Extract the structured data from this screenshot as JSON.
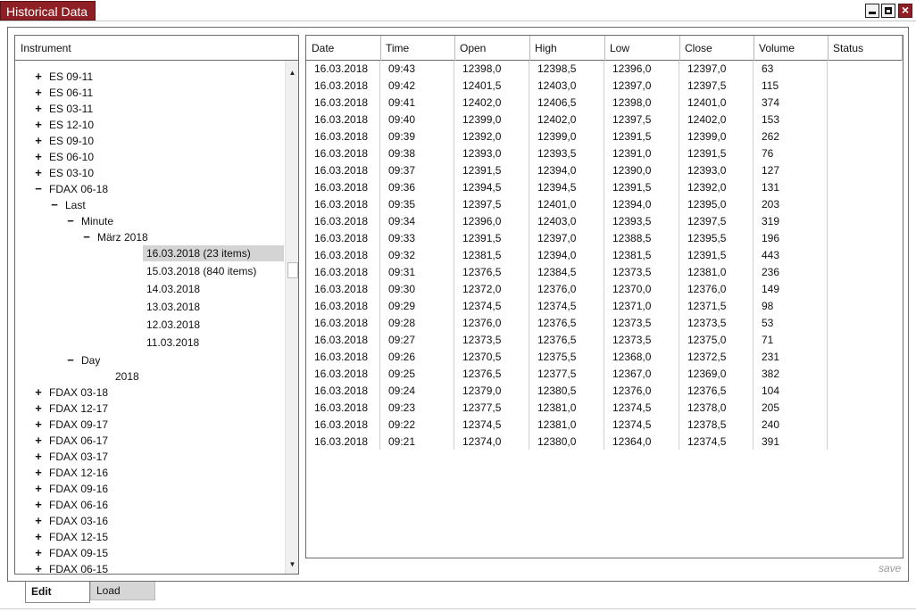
{
  "window": {
    "title": "Historical Data",
    "accent_color": "#8e1f24"
  },
  "tree": {
    "header": "Instrument",
    "items": [
      {
        "label": "ES 09-11",
        "toggle": "+",
        "level": 0
      },
      {
        "label": "ES 06-11",
        "toggle": "+",
        "level": 0
      },
      {
        "label": "ES 03-11",
        "toggle": "+",
        "level": 0
      },
      {
        "label": "ES 12-10",
        "toggle": "+",
        "level": 0
      },
      {
        "label": "ES 09-10",
        "toggle": "+",
        "level": 0
      },
      {
        "label": "ES 06-10",
        "toggle": "+",
        "level": 0
      },
      {
        "label": "ES 03-10",
        "toggle": "+",
        "level": 0
      },
      {
        "label": "FDAX 06-18",
        "toggle": "−",
        "level": 0
      },
      {
        "label": "Last",
        "toggle": "−",
        "level": 1
      },
      {
        "label": "Minute",
        "toggle": "−",
        "level": 2
      },
      {
        "label": "März 2018",
        "toggle": "−",
        "level": 3
      },
      {
        "label": "16.03.2018 (23 items)",
        "toggle": "",
        "level": 4,
        "selected": true
      },
      {
        "label": "15.03.2018 (840 items)",
        "toggle": "",
        "level": 4
      },
      {
        "label": "14.03.2018",
        "toggle": "",
        "level": 4
      },
      {
        "label": "13.03.2018",
        "toggle": "",
        "level": 4
      },
      {
        "label": "12.03.2018",
        "toggle": "",
        "level": 4
      },
      {
        "label": "11.03.2018",
        "toggle": "",
        "level": 4
      },
      {
        "label": "Day",
        "toggle": "−",
        "level": 2
      },
      {
        "label": "2018",
        "toggle": "",
        "level": 3
      },
      {
        "label": "FDAX 03-18",
        "toggle": "+",
        "level": 0
      },
      {
        "label": "FDAX 12-17",
        "toggle": "+",
        "level": 0
      },
      {
        "label": "FDAX 09-17",
        "toggle": "+",
        "level": 0
      },
      {
        "label": "FDAX 06-17",
        "toggle": "+",
        "level": 0
      },
      {
        "label": "FDAX 03-17",
        "toggle": "+",
        "level": 0
      },
      {
        "label": "FDAX 12-16",
        "toggle": "+",
        "level": 0
      },
      {
        "label": "FDAX 09-16",
        "toggle": "+",
        "level": 0
      },
      {
        "label": "FDAX 06-16",
        "toggle": "+",
        "level": 0
      },
      {
        "label": "FDAX 03-16",
        "toggle": "+",
        "level": 0
      },
      {
        "label": "FDAX 12-15",
        "toggle": "+",
        "level": 0
      },
      {
        "label": "FDAX 09-15",
        "toggle": "+",
        "level": 0
      },
      {
        "label": "FDAX 06-15",
        "toggle": "+",
        "level": 0
      }
    ]
  },
  "grid": {
    "columns": [
      "Date",
      "Time",
      "Open",
      "High",
      "Low",
      "Close",
      "Volume",
      "Status"
    ],
    "rows": [
      [
        "16.03.2018",
        "09:43",
        "12398,0",
        "12398,5",
        "12396,0",
        "12397,0",
        "63",
        ""
      ],
      [
        "16.03.2018",
        "09:42",
        "12401,5",
        "12403,0",
        "12397,0",
        "12397,5",
        "115",
        ""
      ],
      [
        "16.03.2018",
        "09:41",
        "12402,0",
        "12406,5",
        "12398,0",
        "12401,0",
        "374",
        ""
      ],
      [
        "16.03.2018",
        "09:40",
        "12399,0",
        "12402,0",
        "12397,5",
        "12402,0",
        "153",
        ""
      ],
      [
        "16.03.2018",
        "09:39",
        "12392,0",
        "12399,0",
        "12391,5",
        "12399,0",
        "262",
        ""
      ],
      [
        "16.03.2018",
        "09:38",
        "12393,0",
        "12393,5",
        "12391,0",
        "12391,5",
        "76",
        ""
      ],
      [
        "16.03.2018",
        "09:37",
        "12391,5",
        "12394,0",
        "12390,0",
        "12393,0",
        "127",
        ""
      ],
      [
        "16.03.2018",
        "09:36",
        "12394,5",
        "12394,5",
        "12391,5",
        "12392,0",
        "131",
        ""
      ],
      [
        "16.03.2018",
        "09:35",
        "12397,5",
        "12401,0",
        "12394,0",
        "12395,0",
        "203",
        ""
      ],
      [
        "16.03.2018",
        "09:34",
        "12396,0",
        "12403,0",
        "12393,5",
        "12397,5",
        "319",
        ""
      ],
      [
        "16.03.2018",
        "09:33",
        "12391,5",
        "12397,0",
        "12388,5",
        "12395,5",
        "196",
        ""
      ],
      [
        "16.03.2018",
        "09:32",
        "12381,5",
        "12394,0",
        "12381,5",
        "12391,5",
        "443",
        ""
      ],
      [
        "16.03.2018",
        "09:31",
        "12376,5",
        "12384,5",
        "12373,5",
        "12381,0",
        "236",
        ""
      ],
      [
        "16.03.2018",
        "09:30",
        "12372,0",
        "12376,0",
        "12370,0",
        "12376,0",
        "149",
        ""
      ],
      [
        "16.03.2018",
        "09:29",
        "12374,5",
        "12374,5",
        "12371,0",
        "12371,5",
        "98",
        ""
      ],
      [
        "16.03.2018",
        "09:28",
        "12376,0",
        "12376,5",
        "12373,5",
        "12373,5",
        "53",
        ""
      ],
      [
        "16.03.2018",
        "09:27",
        "12373,5",
        "12376,5",
        "12373,5",
        "12375,0",
        "71",
        ""
      ],
      [
        "16.03.2018",
        "09:26",
        "12370,5",
        "12375,5",
        "12368,0",
        "12372,5",
        "231",
        ""
      ],
      [
        "16.03.2018",
        "09:25",
        "12376,5",
        "12377,5",
        "12367,0",
        "12369,0",
        "382",
        ""
      ],
      [
        "16.03.2018",
        "09:24",
        "12379,0",
        "12380,5",
        "12376,0",
        "12376,5",
        "104",
        ""
      ],
      [
        "16.03.2018",
        "09:23",
        "12377,5",
        "12381,0",
        "12374,5",
        "12378,0",
        "205",
        ""
      ],
      [
        "16.03.2018",
        "09:22",
        "12374,5",
        "12381,0",
        "12374,5",
        "12378,5",
        "240",
        ""
      ],
      [
        "16.03.2018",
        "09:21",
        "12374,0",
        "12380,0",
        "12364,0",
        "12374,5",
        "391",
        ""
      ]
    ]
  },
  "footer": {
    "save_label": "save",
    "tabs": [
      "Edit",
      "Load"
    ]
  }
}
